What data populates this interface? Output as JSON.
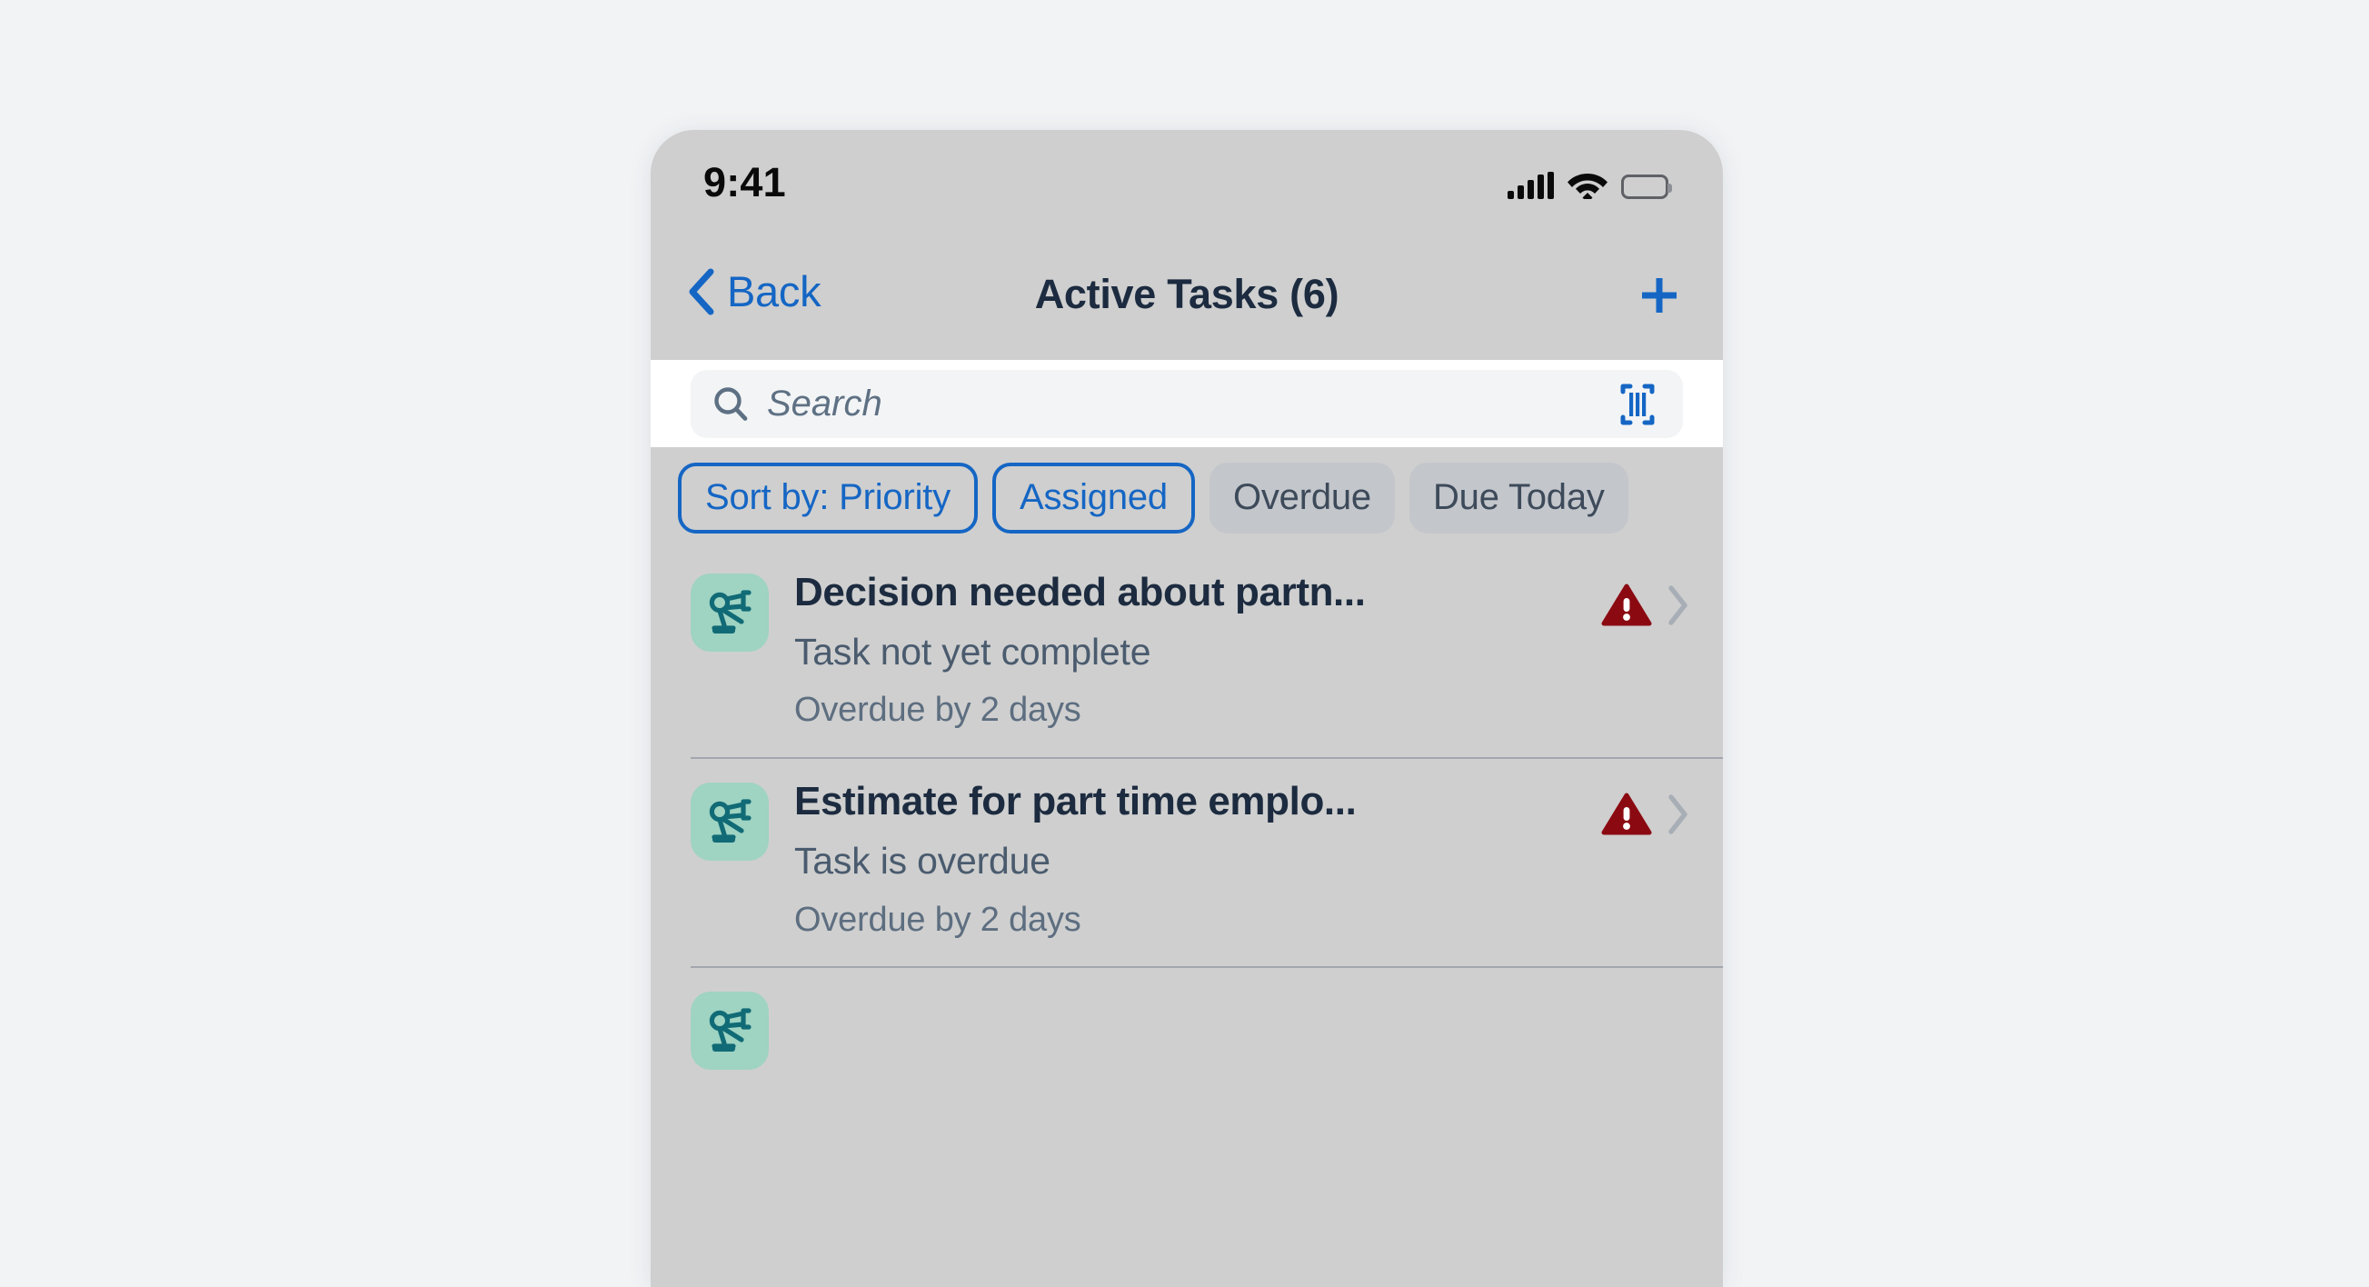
{
  "colors": {
    "page_background": "#F1F3F5",
    "phone_background": "#CFCFCF",
    "accent_blue": "#1566C4",
    "title_navy": "#1C2B3F",
    "subtitle_gray": "#4A5B6E",
    "meta_gray": "#5D6E80",
    "search_band": "#FFFFFF",
    "search_field": "#F2F4F6",
    "chip_unselected": "#C3C6CB",
    "divider": "#A2A6AE",
    "icon_tile_mint": "#9FD3C2",
    "icon_stroke_teal": "#116B76",
    "warning_red": "#8B0A12",
    "chevron_gray": "#A8AEB6"
  },
  "status_bar": {
    "time": "9:41",
    "signal_icon": "cellular-signal-icon",
    "wifi_icon": "wifi-icon",
    "battery_icon": "battery-full-icon"
  },
  "nav_bar": {
    "back_label": "Back",
    "back_icon": "chevron-left-icon",
    "title": "Active Tasks (6)",
    "add_icon": "plus-icon"
  },
  "search": {
    "placeholder": "Search",
    "value": "",
    "search_icon": "search-icon",
    "scan_icon": "barcode-scan-icon"
  },
  "chips": [
    {
      "label": "Sort by: Priority",
      "selected": true
    },
    {
      "label": "Assigned",
      "selected": true
    },
    {
      "label": "Overdue",
      "selected": false
    },
    {
      "label": "Due Today",
      "selected": false
    }
  ],
  "tasks": [
    {
      "icon": "robotic-arm-icon",
      "title": "Decision needed about partn...",
      "subtitle": "Task not yet complete",
      "meta": "Overdue by 2 days",
      "warning_icon": "warning-triangle-icon",
      "chevron_icon": "chevron-right-icon"
    },
    {
      "icon": "robotic-arm-icon",
      "title": "Estimate for part time emplo...",
      "subtitle": "Task is overdue",
      "meta": "Overdue by 2 days",
      "warning_icon": "warning-triangle-icon",
      "chevron_icon": "chevron-right-icon"
    }
  ]
}
